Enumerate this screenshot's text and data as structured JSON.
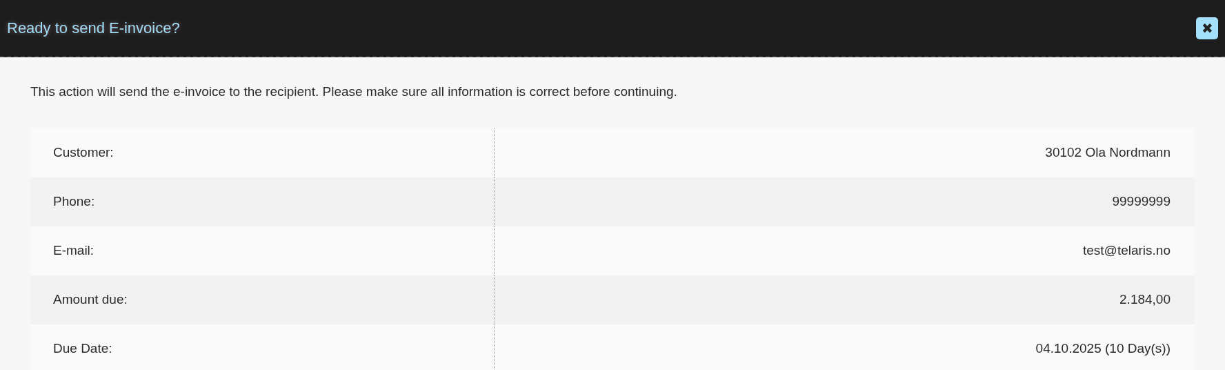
{
  "dialog": {
    "title": "Ready to send E-invoice?",
    "close_button": "✖"
  },
  "message": "This action will send the e-invoice to the recipient. Please make sure all information is correct before continuing.",
  "details": [
    {
      "label": "Customer:",
      "value": "30102 Ola Nordmann"
    },
    {
      "label": "Phone:",
      "value": "99999999"
    },
    {
      "label": "E-mail:",
      "value": "test@telaris.no"
    },
    {
      "label": "Amount due:",
      "value": "2.184,00"
    },
    {
      "label": "Due Date:",
      "value": "04.10.2025 (10 Day(s))"
    }
  ]
}
